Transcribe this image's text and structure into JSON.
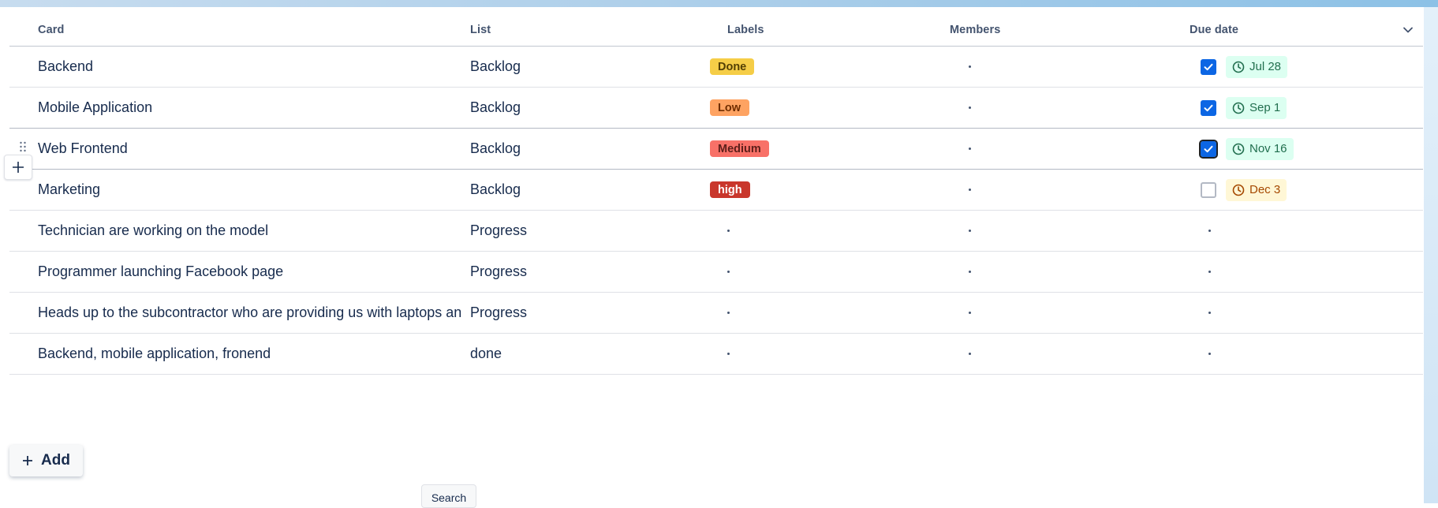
{
  "header": {
    "card": "Card",
    "list": "List",
    "labels": "Labels",
    "members": "Members",
    "due_date": "Due date"
  },
  "rows": [
    {
      "card": "Backend",
      "list": "Backlog",
      "label": "Done",
      "label_bg": "#f5cd47",
      "label_fg": "#533f04",
      "due_checked": true,
      "due": "Jul 28",
      "due_tone": "green"
    },
    {
      "card": "Mobile Application",
      "list": "Backlog",
      "label": "Low",
      "label_bg": "#fea362",
      "label_fg": "#702e00",
      "due_checked": true,
      "due": "Sep 1",
      "due_tone": "green"
    },
    {
      "card": "Web Frontend",
      "list": "Backlog",
      "label": "Medium",
      "label_bg": "#f87168",
      "label_fg": "#5d1f1a",
      "due_checked": true,
      "due": "Nov 16",
      "due_tone": "green"
    },
    {
      "card": "Marketing",
      "list": "Backlog",
      "label": "high",
      "label_bg": "#c9372c",
      "label_fg": "#ffffff",
      "due_checked": false,
      "due": "Dec 3",
      "due_tone": "yellow"
    },
    {
      "card": "Technician are working on the model",
      "list": "Progress"
    },
    {
      "card": "Programmer launching Facebook page",
      "list": "Progress"
    },
    {
      "card": "Heads up to the subcontractor who are providing us with laptops and",
      "list": "Progress"
    },
    {
      "card": "Backend, mobile application, fronend",
      "list": "done"
    }
  ],
  "actions": {
    "add_label": "Add",
    "search_label": "Search"
  },
  "icons": {
    "header_menu": "chevron-down-icon",
    "drag": "drag-handle-icon",
    "add_row": "plus-icon",
    "due": "clock-icon",
    "checkbox": "check-icon"
  },
  "colors": {
    "checkbox_checked": "#0c66e4",
    "due_green_bg": "#dcfff1",
    "due_green_fg": "#216e4e",
    "due_yellow_bg": "#fff7d6",
    "due_yellow_fg": "#a54800"
  }
}
